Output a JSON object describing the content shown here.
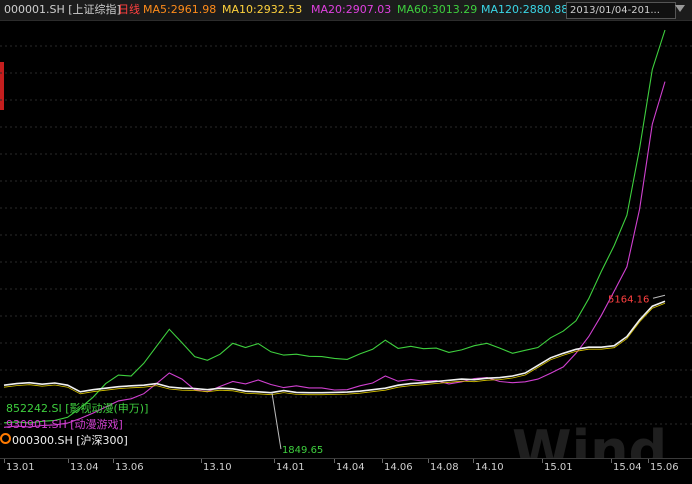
{
  "header": {
    "symbol": "000001.SH [上证综指]",
    "period": "日线",
    "indicators": [
      {
        "label": "MA5:2961.98",
        "color": "#ff8c1a"
      },
      {
        "label": "MA10:2932.53",
        "color": "#ffd23c"
      },
      {
        "label": "MA20:2907.03",
        "color": "#e040e0"
      },
      {
        "label": "MA60:3013.29",
        "color": "#3ecf3e"
      },
      {
        "label": "MA120:2880.88",
        "color": "#3ad6e6"
      }
    ],
    "date_range": "2013/01/04-201..."
  },
  "chart_data": {
    "type": "line",
    "x_tick_labels": [
      "13.01",
      "13.04",
      "13.06",
      "13.10",
      "14.01",
      "14.04",
      "14.06",
      "14.08",
      "14.10",
      "15.01",
      "15.04",
      "15.06"
    ],
    "annotations": {
      "min_label": "1849.65",
      "max_label": "5164.16"
    },
    "watermark": "Wind",
    "grid": true,
    "legend_position": "bottom-left",
    "series": [
      {
        "name": "852242.SI [影视动漫(申万)]",
        "color": "#3ecf3e",
        "values": [
          1160,
          1190,
          1155,
          1210,
          1240,
          1340,
          1650,
          2000,
          2450,
          2730,
          2700,
          3120,
          3680,
          4240,
          3800,
          3340,
          3220,
          3420,
          3780,
          3640,
          3770,
          3500,
          3390,
          3420,
          3350,
          3340,
          3280,
          3250,
          3430,
          3580,
          3880,
          3610,
          3680,
          3600,
          3620,
          3480,
          3560,
          3700,
          3780,
          3620,
          3450,
          3550,
          3640,
          3960,
          4180,
          4520,
          5250,
          6150,
          7000,
          8000,
          10200,
          12800,
          14100
        ]
      },
      {
        "name": "930901.SH [动漫游戏]",
        "color": "#d040d0",
        "values": [
          1010,
          1050,
          1020,
          1070,
          1090,
          1150,
          1300,
          1480,
          1680,
          1880,
          1950,
          2120,
          2450,
          2800,
          2600,
          2250,
          2180,
          2360,
          2520,
          2440,
          2570,
          2420,
          2320,
          2380,
          2310,
          2310,
          2240,
          2250,
          2380,
          2470,
          2700,
          2530,
          2590,
          2530,
          2550,
          2440,
          2510,
          2620,
          2650,
          2520,
          2480,
          2510,
          2600,
          2790,
          3000,
          3450,
          4000,
          4700,
          5500,
          6300,
          8200,
          11000,
          12400
        ]
      },
      {
        "name": "000300.SH [沪深300]",
        "color": "#f2f2f2",
        "values": [
          2400,
          2450,
          2480,
          2430,
          2470,
          2400,
          2180,
          2250,
          2300,
          2350,
          2380,
          2400,
          2450,
          2340,
          2300,
          2290,
          2250,
          2300,
          2280,
          2200,
          2180,
          2150,
          2220,
          2160,
          2150,
          2150,
          2160,
          2170,
          2200,
          2250,
          2300,
          2400,
          2450,
          2480,
          2520,
          2560,
          2600,
          2580,
          2630,
          2650,
          2700,
          2800,
          3050,
          3300,
          3450,
          3580,
          3650,
          3650,
          3700,
          4000,
          4550,
          5000,
          5164.16
        ]
      }
    ]
  }
}
